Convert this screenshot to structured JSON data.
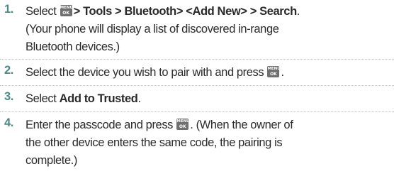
{
  "steps": [
    {
      "number": "1.",
      "line1": {
        "pre": "Select",
        "key": {
          "top": "MENU",
          "bottom": "OK"
        },
        "path": "> Tools > Bluetooth> <Add New> > Search",
        "post": "."
      },
      "line2": "(Your phone will display a list of discovered in-range",
      "line3": "Bluetooth devices.)"
    },
    {
      "number": "2.",
      "line1": {
        "pre": "Select the device you wish to pair with and press",
        "key": {
          "top": "MENU",
          "bottom": "OK"
        },
        "post": "."
      }
    },
    {
      "number": "3.",
      "line1": {
        "pre": "Select",
        "bold": "Add to Trusted",
        "post": "."
      }
    },
    {
      "number": "4.",
      "line1": {
        "pre": "Enter the passcode and press",
        "key": {
          "top": "MENU",
          "bottom": "OK"
        },
        "post": ". (When the owner of"
      },
      "line2": "the other device enters the same code, the pairing is",
      "line3": "complete.)"
    }
  ]
}
